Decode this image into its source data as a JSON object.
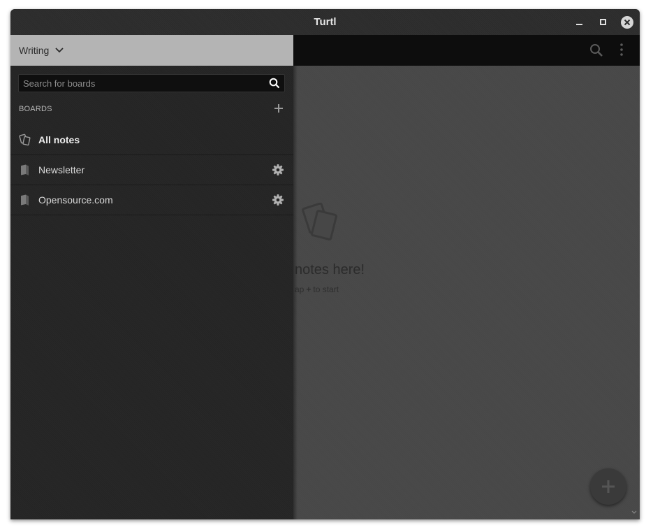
{
  "window": {
    "title": "Turtl"
  },
  "sidebar": {
    "space_name": "Writing",
    "search_placeholder": "Search for boards",
    "boards_heading": "BOARDS",
    "items": [
      {
        "label": "All notes"
      },
      {
        "label": "Newsletter"
      },
      {
        "label": "Opensource.com"
      }
    ]
  },
  "main": {
    "empty_title": "notes here!",
    "empty_sub_prefix": "ap",
    "empty_sub_suffix": "to start"
  },
  "colors": {
    "titlebar": "#2b2b2b",
    "sidebar": "#242424",
    "sidebar_header": "#b4b4b4",
    "main": "#474747",
    "topbar": "#0d0d0d"
  }
}
